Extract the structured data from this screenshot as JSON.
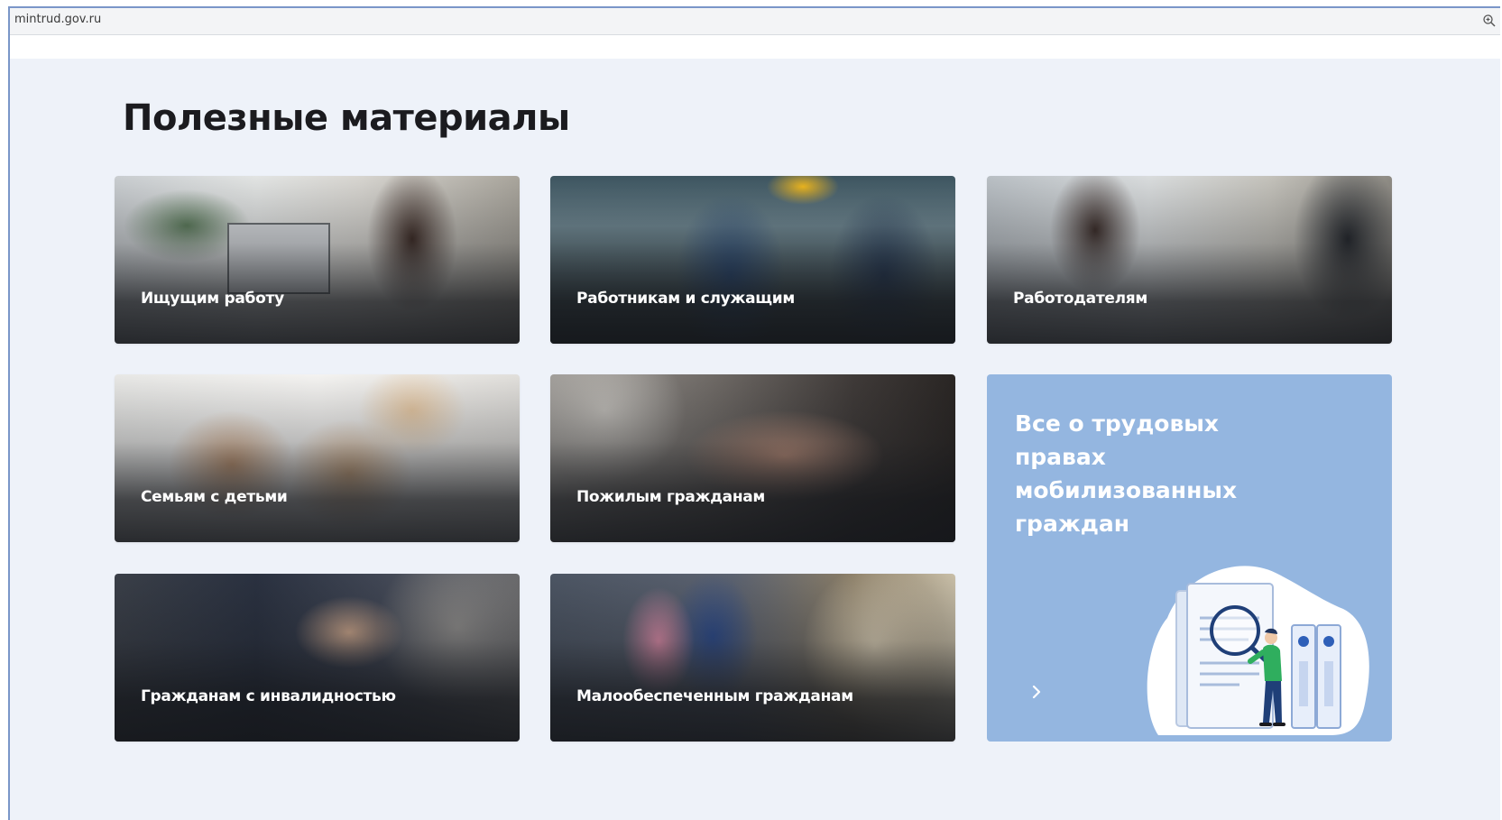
{
  "browser": {
    "url": "mintrud.gov.ru",
    "zoom_icon": "zoom-in-icon"
  },
  "section": {
    "title": "Полезные материалы"
  },
  "cards": [
    {
      "label": "Ищущим работу",
      "image": "woman-on-phone-photo"
    },
    {
      "label": "Работникам и служащим",
      "image": "factory-workers-photo"
    },
    {
      "label": "Работодателям",
      "image": "office-team-photo"
    },
    {
      "label": "Семьям с детьми",
      "image": "family-with-children-photo"
    },
    {
      "label": "Пожилым гражданам",
      "image": "elderly-hands-photo"
    },
    {
      "label": "Гражданам с инвалидностью",
      "image": "wheelchair-photo"
    },
    {
      "label": "Малообеспеченным гражданам",
      "image": "mother-and-child-photo"
    }
  ],
  "feature": {
    "title": "Все о трудовых правах мобилизованных граждан",
    "arrow_icon": "chevron-right-icon",
    "illustration": "document-magnifier-illustration",
    "background": "#94b6e0"
  }
}
